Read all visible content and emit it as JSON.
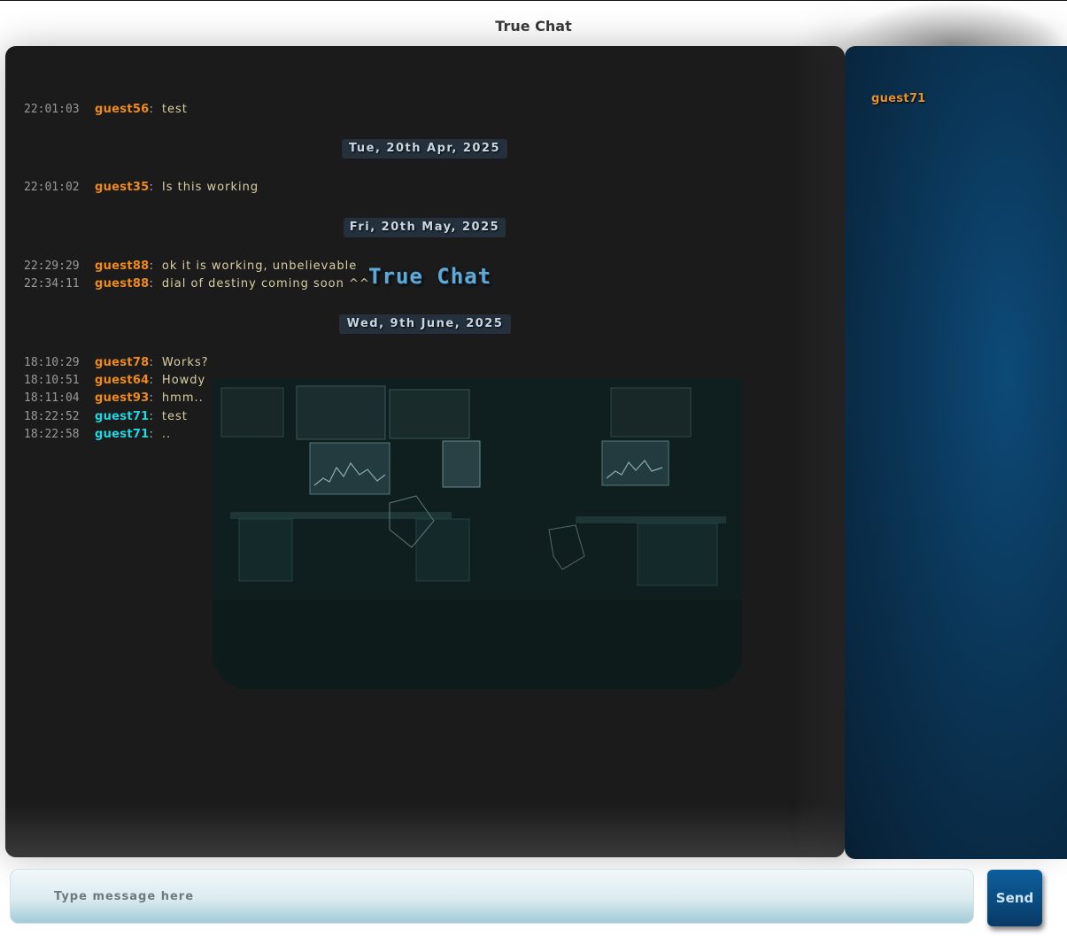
{
  "app": {
    "title": "True Chat"
  },
  "watermark": {
    "text": "True Chat"
  },
  "messages": [
    {
      "time": "22:01:03",
      "user": "guest56",
      "text": "test",
      "self": false
    },
    {
      "time": "22:01:02",
      "user": "guest35",
      "text": "Is this working",
      "self": false
    },
    {
      "time": "22:29:29",
      "user": "guest88",
      "text": "ok it is working, unbelievable",
      "self": false
    },
    {
      "time": "22:34:11",
      "user": "guest88",
      "text": "dial of destiny coming soon ^^",
      "self": false
    },
    {
      "time": "18:10:29",
      "user": "guest78",
      "text": "Works?",
      "self": false
    },
    {
      "time": "18:10:51",
      "user": "guest64",
      "text": "Howdy",
      "self": false
    },
    {
      "time": "18:11:04",
      "user": "guest93",
      "text": "hmm..",
      "self": false
    },
    {
      "time": "18:22:52",
      "user": "guest71",
      "text": "test",
      "self": true
    },
    {
      "time": "18:22:58",
      "user": "guest71",
      "text": "..",
      "self": true
    }
  ],
  "date_separators": [
    "Tue, 20th Apr, 2025",
    "Fri, 20th May, 2025",
    "Wed, 9th June, 2025"
  ],
  "users": [
    "guest71"
  ],
  "colors": {
    "other_user": "#f08a1c",
    "self_user": "#21d6e0",
    "message_text": "#d9cfa6"
  },
  "composer": {
    "placeholder": "Type message here",
    "value": "",
    "send_label": "Send"
  }
}
